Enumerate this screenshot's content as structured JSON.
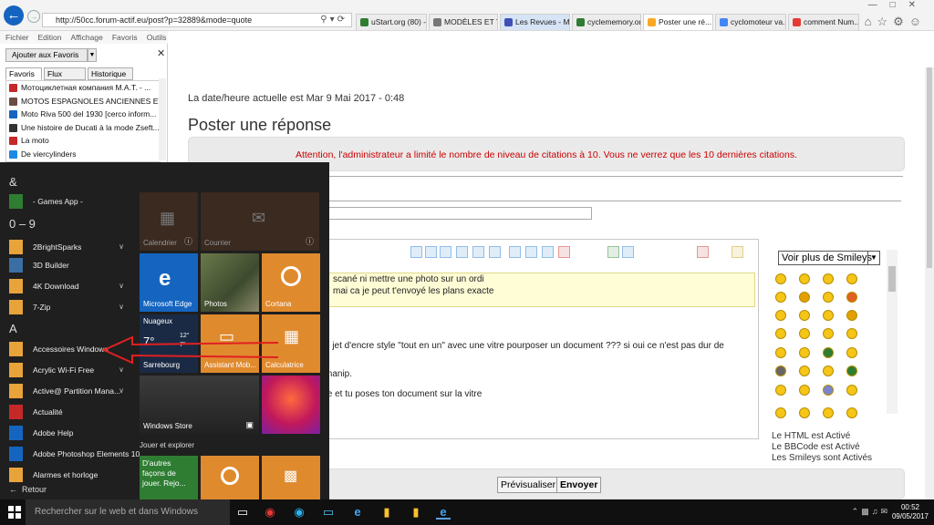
{
  "browser": {
    "url": "http://50cc.forum-actif.eu/post?p=32889&mode=quote",
    "tabs": [
      {
        "label": "uStart.org (80) - ...",
        "color": "#2e7d32"
      },
      {
        "label": "MODÈLES ET TY...",
        "color": "#777777"
      },
      {
        "label": "Les Revues - Mé...",
        "color": "#3f51b5"
      },
      {
        "label": "cyclememory.org",
        "color": "#2e7d32"
      },
      {
        "label": "Poster une ré...",
        "color": "#f9a825"
      },
      {
        "label": "cyclomoteur va...",
        "color": "#4285f4"
      },
      {
        "label": "comment Num...",
        "color": "#e53935"
      }
    ],
    "menu": [
      "Fichier",
      "Edition",
      "Affichage",
      "Favoris",
      "Outils"
    ]
  },
  "favorites": {
    "add_button": "Ajouter aux Favoris",
    "tabs": [
      "Favoris",
      "Flux",
      "Historique"
    ],
    "items": [
      {
        "label": "Мотоциклетная компания M.A.T. - ...",
        "color": "#c62828"
      },
      {
        "label": "MOTOS ESPAGNOLES ANCIENNES ET ...",
        "color": "#6d4c41"
      },
      {
        "label": "Moto Riva 500 del 1930 [cerco inform...",
        "color": "#1565c0"
      },
      {
        "label": "Une histoire de Ducati à la mode Zseft...",
        "color": "#333333"
      },
      {
        "label": "La moto",
        "color": "#c62828"
      },
      {
        "label": "De viercylinders",
        "color": "#1e88e5"
      }
    ]
  },
  "page": {
    "datetime": "La date/heure actuelle est Mar 9 Mai 2017 - 0:48",
    "title": "Poster une réponse",
    "warning": "Attention, l'administrateur a limité le nombre de niveau de citations à 10. Vous ne verrez que les 10 dernières citations.",
    "quote_lines": [
      "scané ni mettre une photo sur un ordi",
      "mai ca je peut t'envoyé les plans exacte"
    ],
    "body_lines": [
      "e jet d'encre style \"tout en un\" avec une vitre pourposer un document ???  si oui ce n'est pas dur de",
      "manip.",
      "te et tu poses ton document sur la vitre"
    ],
    "smiley_select": "Voir plus de Smileys",
    "status": [
      "Le HTML est Activé",
      "Le BBCode est Activé",
      "Les Smileys sont Activés"
    ],
    "preview_button": "Prévisualiser",
    "send_button": "Envoyer"
  },
  "startmenu": {
    "headers": [
      "&",
      "0 – 9",
      "A"
    ],
    "apps": [
      {
        "label": "- Games App -",
        "color": "#2e7d32",
        "chevron": false
      },
      {
        "label": "2BrightSparks",
        "color": "#e8a33a",
        "chevron": true
      },
      {
        "label": "3D Builder",
        "color": "#3a6ea5",
        "chevron": false
      },
      {
        "label": "4K Download",
        "color": "#e8a33a",
        "chevron": true
      },
      {
        "label": "7-Zip",
        "color": "#e8a33a",
        "chevron": true
      },
      {
        "label": "Accessoires Windows",
        "color": "#e8a33a",
        "chevron": false
      },
      {
        "label": "Acrylic Wi-Fi Free",
        "color": "#e8a33a",
        "chevron": true
      },
      {
        "label": "Active@ Partition Mana...",
        "color": "#e8a33a",
        "chevron": true
      },
      {
        "label": "Actualité",
        "color": "#c62828",
        "chevron": false
      },
      {
        "label": "Adobe Help",
        "color": "#1565c0",
        "chevron": false
      },
      {
        "label": "Adobe Photoshop Elements 10",
        "color": "#1565c0",
        "chevron": false
      },
      {
        "label": "Alarmes et horloge",
        "color": "#e8a33a",
        "chevron": false
      }
    ],
    "tiles": {
      "calendrier": "Calendrier",
      "courrier": "Courrier",
      "edge": "Microsoft Edge",
      "photos": "Photos",
      "cortana": "Cortana",
      "weather_title": "Nuageux",
      "weather_temp": "7°",
      "weather_hi": "12°",
      "weather_lo": "7°",
      "weather_city": "Sarrebourg",
      "assistant": "Assistant Mob...",
      "calculatrice": "Calculatrice",
      "store": "Windows Store",
      "group_label": "Jouer et explorer",
      "autres": "D'autres façons de jouer. Rejo..."
    },
    "back": "Retour"
  },
  "taskbar": {
    "search_placeholder": "Rechercher sur le web et dans Windows",
    "time": "00:52",
    "date": "09/05/2017"
  }
}
